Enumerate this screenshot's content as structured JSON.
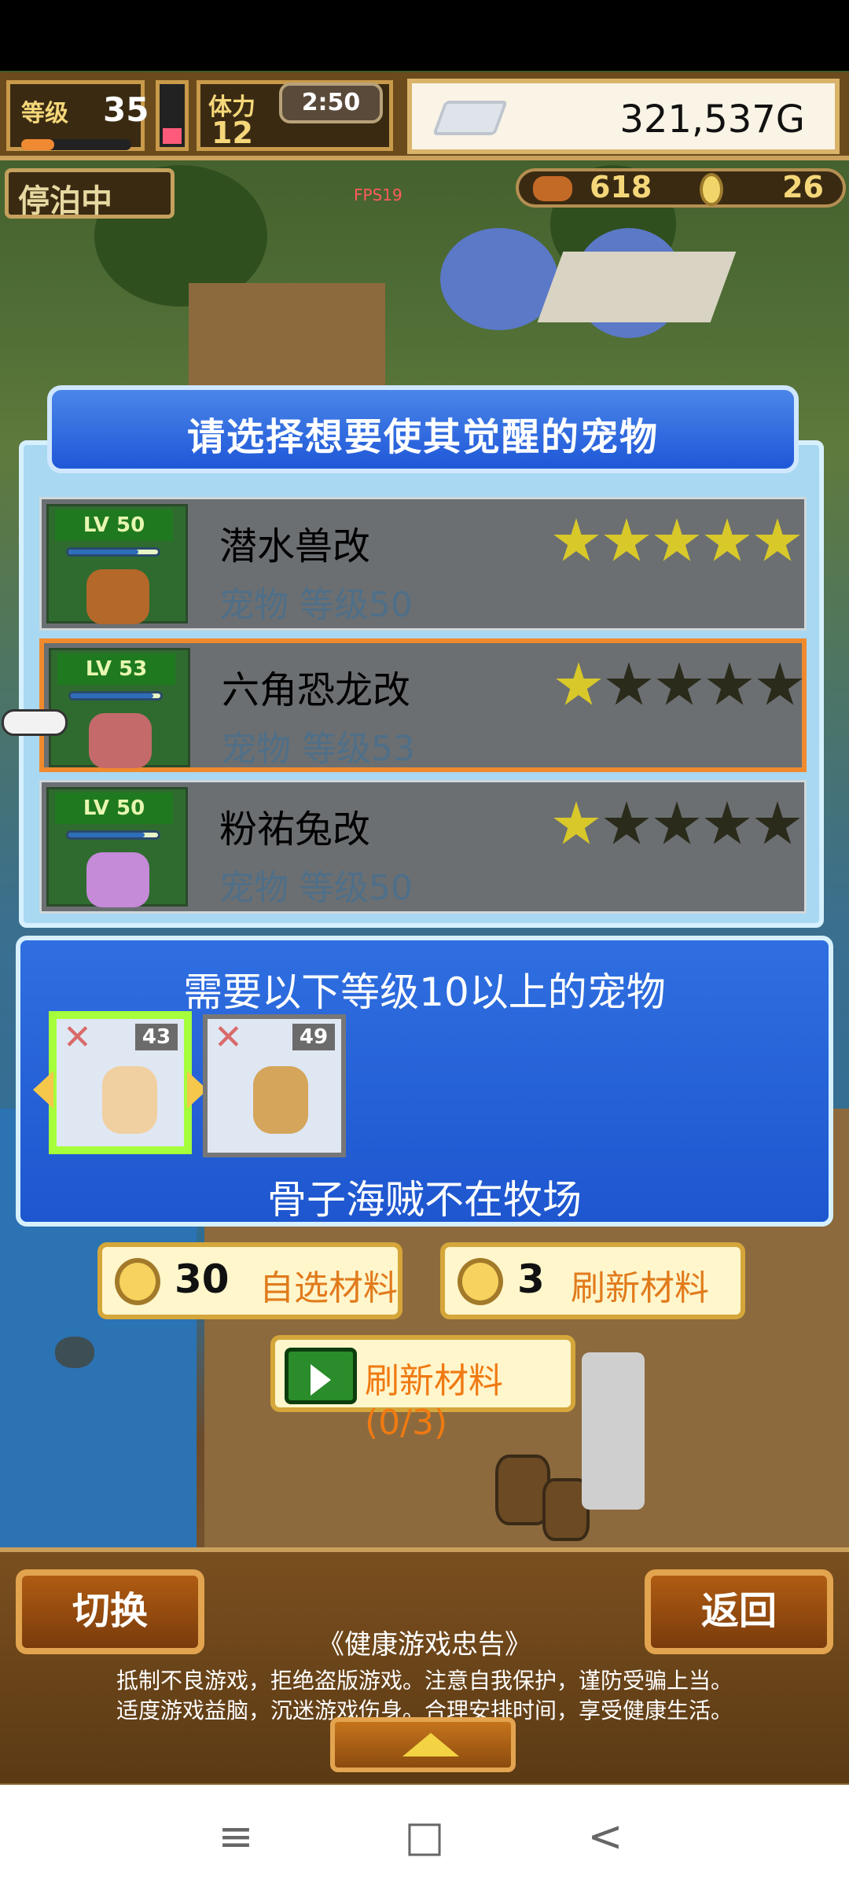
{
  "hud": {
    "level_label": "等级",
    "level_value": "35",
    "stamina_label": "体力",
    "stamina_value": "12",
    "timer": "2:50",
    "gold": "321,537G",
    "dock_status": "停泊中",
    "fps": "FPS19",
    "food_count": "618",
    "coin_count": "26"
  },
  "dialog": {
    "title": "请选择想要使其觉醒的宠物",
    "pets": [
      {
        "lv": "LV 50",
        "name": "潜水兽改",
        "sub": "宠物 等级50",
        "stars_on": 5,
        "stars_total": 5
      },
      {
        "lv": "LV 53",
        "name": "六角恐龙改",
        "sub": "宠物 等级53",
        "stars_on": 1,
        "stars_total": 5,
        "selected": true
      },
      {
        "lv": "LV 50",
        "name": "粉祐兔改",
        "sub": "宠物 等级50",
        "stars_on": 1,
        "stars_total": 5
      }
    ],
    "requirement": {
      "title": "需要以下等级10以上的宠物",
      "pets": [
        {
          "level": "43",
          "active": true
        },
        {
          "level": "49",
          "active": false
        }
      ],
      "status": "骨子海贼不在牧场"
    }
  },
  "actions": {
    "select_cost": "30",
    "select_label": "自选材料",
    "refresh_cost": "3",
    "refresh_label": "刷新材料",
    "ad_refresh_label": "刷新材料(0/3)"
  },
  "bottom": {
    "switch_label": "切换",
    "back_label": "返回",
    "notice_title": "《健康游戏忠告》",
    "notice_line1": "抵制不良游戏，拒绝盗版游戏。注意自我保护，谨防受骗上当。",
    "notice_line2": "适度游戏益脑，沉迷游戏伤身。合理安排时间，享受健康生活。"
  },
  "nav": {
    "menu_icon": "≡",
    "home_icon": "□",
    "back_icon": "<"
  },
  "colors": {
    "star_on": "#d8c82a",
    "star_off": "#2b2b1b",
    "selection": "#f08a2e",
    "panel_blue": "#1f57d8"
  }
}
